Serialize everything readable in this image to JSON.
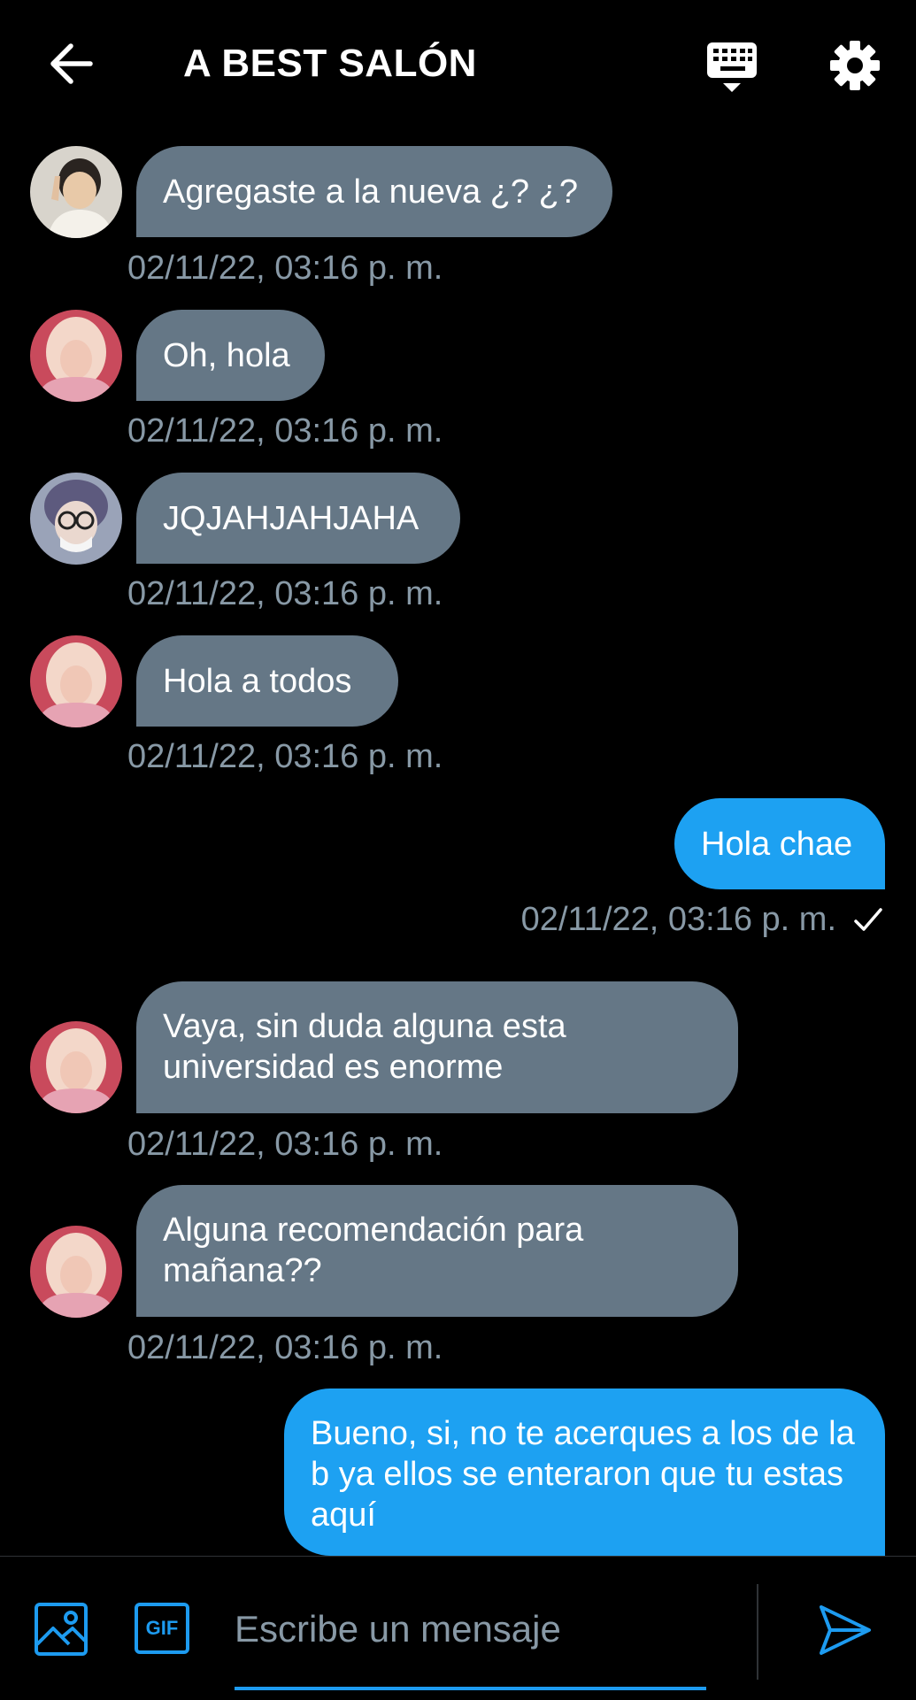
{
  "header": {
    "title": "A BEST SALÓN",
    "back_icon": "arrow-left-icon",
    "keyboard_icon": "keyboard-icon",
    "settings_icon": "gear-icon"
  },
  "messages": [
    {
      "direction": "in",
      "avatar": "avatar-boy",
      "text": "Agregaste a la nueva ¿? ¿?",
      "time": "02/11/22, 03:16 p. m."
    },
    {
      "direction": "in",
      "avatar": "avatar-girl-pink",
      "text": "Oh, hola",
      "time": "02/11/22, 03:16 p. m."
    },
    {
      "direction": "in",
      "avatar": "avatar-glasses",
      "text": "JQJAHJAHJAHA",
      "time": "02/11/22, 03:16 p. m."
    },
    {
      "direction": "in",
      "avatar": "avatar-girl-pink",
      "text": "Hola a todos",
      "time": "02/11/22, 03:16 p. m."
    },
    {
      "direction": "out",
      "text": "Hola chae",
      "time": "02/11/22, 03:16 p. m.",
      "status": "sent"
    },
    {
      "direction": "in",
      "avatar": "avatar-girl-pink",
      "text": "Vaya, sin duda alguna esta universidad es enorme",
      "time": "02/11/22, 03:16 p. m."
    },
    {
      "direction": "in",
      "avatar": "avatar-girl-pink",
      "text": "Alguna recomendación para mañana??",
      "time": "02/11/22, 03:16 p. m."
    },
    {
      "direction": "out",
      "text": "Bueno, si, no te acerques a los de la b ya ellos se enteraron que tu estas aquí"
    }
  ],
  "composer": {
    "placeholder": "Escribe un mensaje",
    "gif_label": "GIF",
    "image_icon": "image-icon",
    "send_icon": "send-icon"
  },
  "colors": {
    "background": "#000000",
    "incoming_bubble": "#657786",
    "outgoing_bubble": "#1da1f2",
    "timestamp": "#8899a6",
    "accent": "#1d9bf0"
  }
}
